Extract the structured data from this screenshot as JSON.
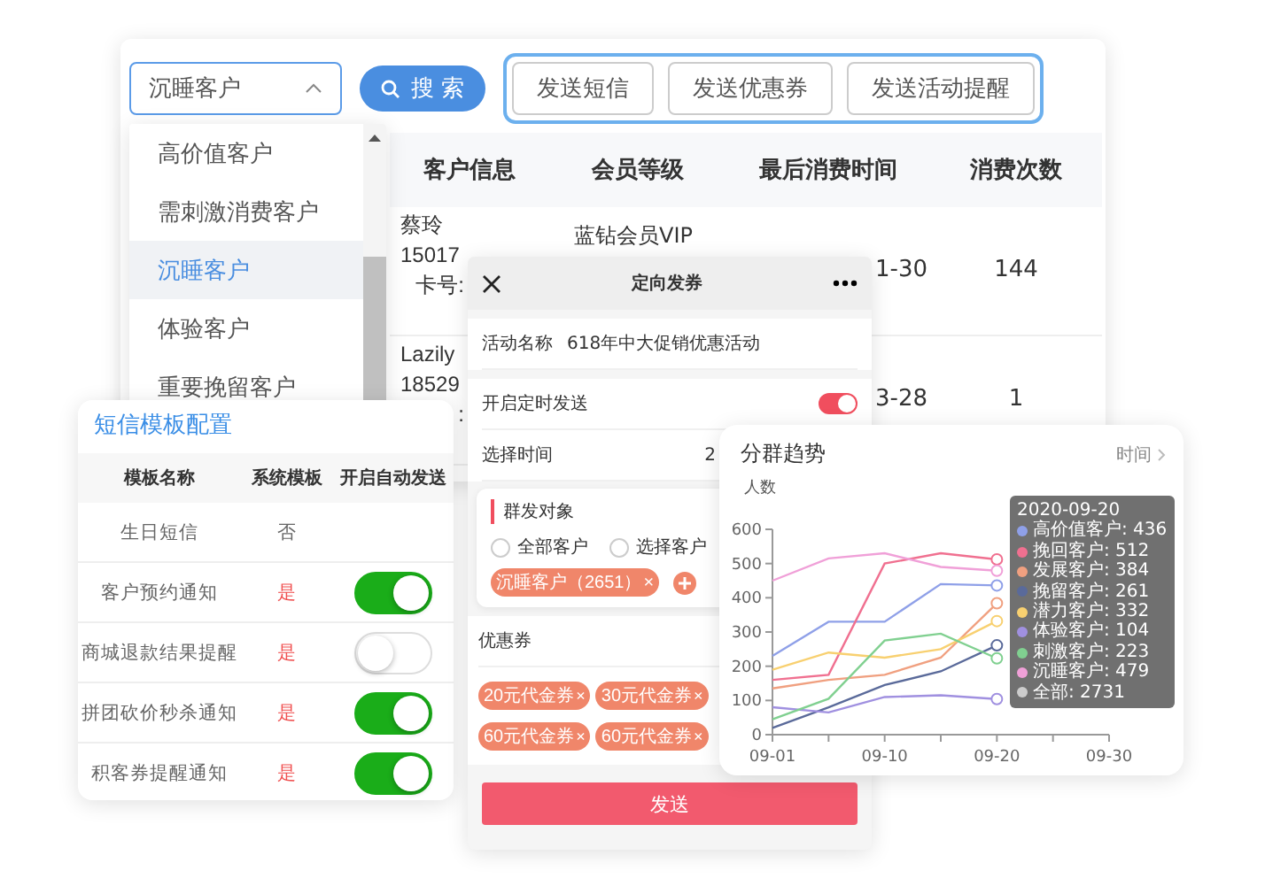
{
  "filter": {
    "select": {
      "value": "沉睡客户",
      "expanded": true
    },
    "search_button": "搜 索"
  },
  "actions": [
    "发送短信",
    "发送优惠券",
    "发送活动提醒"
  ],
  "dropdown": {
    "items": [
      {
        "label": "高价值客户",
        "selected": false
      },
      {
        "label": "需刺激消费客户",
        "selected": false
      },
      {
        "label": "沉睡客户",
        "selected": true
      },
      {
        "label": "体验客户",
        "selected": false
      },
      {
        "label": "重要挽留客户",
        "selected": false
      }
    ]
  },
  "table": {
    "columns": [
      "客户信息",
      "会员等级",
      "最后消费时间",
      "消费次数"
    ],
    "rows": [
      {
        "info": [
          "蔡玲",
          "15017",
          "卡号:"
        ],
        "level": "蓝钻会员VIP",
        "last_time": "1-30",
        "count": "144"
      },
      {
        "info": [
          "Lazily",
          "18529",
          ":"
        ],
        "last_time": "3-28",
        "count": "1"
      }
    ]
  },
  "sms_config": {
    "title": "短信模板配置",
    "columns": [
      "模板名称",
      "系统模板",
      "开启自动发送"
    ],
    "rows": [
      {
        "kind": "plain",
        "name": "生日短信",
        "system": "否",
        "system_highlight": false
      },
      {
        "kind": "toggle",
        "name": "客户预约通知",
        "system": "是",
        "system_highlight": true,
        "on": true
      },
      {
        "kind": "toggle",
        "name": "商城退款结果提醒",
        "system": "是",
        "system_highlight": true,
        "on": false
      },
      {
        "kind": "toggle",
        "name": "拼团砍价秒杀通知",
        "system": "是",
        "system_highlight": true,
        "on": true
      },
      {
        "kind": "toggle",
        "name": "积客券提醒通知",
        "system": "是",
        "system_highlight": true,
        "on": true
      }
    ]
  },
  "coupon_modal": {
    "title": "定向发券",
    "campaign_label": "活动名称",
    "campaign_value": "618年中大促销优惠活动",
    "schedule_label": "开启定时发送",
    "schedule_on": true,
    "time_label": "选择时间",
    "time_value": "2",
    "group_title": "群发对象",
    "radios": [
      {
        "label": "全部客户",
        "selected": false
      },
      {
        "label": "选择客户",
        "selected": false
      }
    ],
    "group_tag": "沉睡客户（2651）",
    "group_tag_close": "×",
    "coupons_label": "优惠券",
    "coupons": [
      {
        "label": "20元代金券",
        "close": "×"
      },
      {
        "label": "30元代金券",
        "close": "×"
      },
      {
        "label": "60元代金券",
        "close": "×"
      },
      {
        "label": "60元代金券",
        "close": "×"
      }
    ],
    "send_button": "发送"
  },
  "trend_card": {
    "title": "分群趋势",
    "time_link": "时间",
    "chart_data": {
      "type": "line",
      "ylabel": "人数",
      "categories": [
        "09-01",
        null,
        "09-10",
        null,
        "09-20",
        null,
        "09-30"
      ],
      "ylim": [
        0,
        600
      ],
      "yticks": [
        0,
        100,
        200,
        300,
        400,
        500,
        600
      ],
      "series": [
        {
          "color": "#8fa0e8",
          "values": [
            230,
            330,
            330,
            440,
            436,
            null,
            null
          ]
        },
        {
          "color": "#f07090",
          "values": [
            160,
            175,
            500,
            530,
            512,
            null,
            null
          ]
        },
        {
          "color": "#f0a080",
          "values": [
            135,
            160,
            175,
            225,
            384,
            null,
            null
          ]
        },
        {
          "color": "#5a6a9a",
          "values": [
            20,
            80,
            145,
            185,
            261,
            null,
            null
          ]
        },
        {
          "color": "#f8d070",
          "values": [
            190,
            240,
            225,
            250,
            332,
            null,
            null
          ]
        },
        {
          "color": "#a090e0",
          "values": [
            80,
            65,
            110,
            115,
            104,
            null,
            null
          ]
        },
        {
          "color": "#80d090",
          "values": [
            45,
            105,
            275,
            295,
            223,
            null,
            null
          ]
        },
        {
          "color": "#f0a0d8",
          "values": [
            450,
            515,
            530,
            490,
            479,
            null,
            null
          ]
        }
      ]
    },
    "tooltip": {
      "date": "2020-09-20",
      "items": [
        {
          "label": "高价值客户: 436",
          "color": "#8fa0e8"
        },
        {
          "label": "挽回客户: 512",
          "color": "#f07090"
        },
        {
          "label": "发展客户: 384",
          "color": "#f0a080"
        },
        {
          "label": "挽留客户: 261",
          "color": "#5a6a9a"
        },
        {
          "label": "潜力客户: 332",
          "color": "#f8d070"
        },
        {
          "label": "体验客户: 104",
          "color": "#a090e0"
        },
        {
          "label": "刺激客户: 223",
          "color": "#80d090"
        },
        {
          "label": "沉睡客户: 479",
          "color": "#f0a0d8"
        },
        {
          "label": "全部: 2731",
          "color": "#cccccc"
        }
      ]
    }
  }
}
